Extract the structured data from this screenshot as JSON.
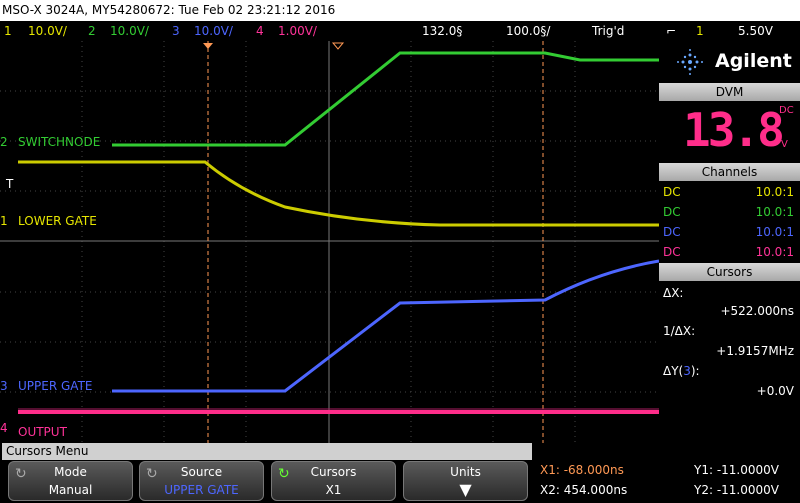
{
  "title_bar": "MSO-X 3024A, MY54280672: Tue Feb 02 23:21:12 2016",
  "channel_bar": {
    "ch1": {
      "num": "1",
      "scale": "10.0V/",
      "color": "#e6e600"
    },
    "ch2": {
      "num": "2",
      "scale": "10.0V/",
      "color": "#33cc33"
    },
    "ch3": {
      "num": "3",
      "scale": "10.0V/",
      "color": "#4d66ff"
    },
    "ch4": {
      "num": "4",
      "scale": "1.00V/",
      "color": "#ff3399"
    },
    "timebase": "132.0§",
    "timediv": "100.0§/",
    "trig_status": "Trig'd",
    "trig_source": "1",
    "trig_level": "5.50V"
  },
  "traces": {
    "switchnode": "SWITCHNODE",
    "lower_gate": "LOWER GATE",
    "upper_gate": "UPPER GATE",
    "output": "OUTPUT",
    "marker_2": "2",
    "marker_1": "1",
    "marker_3": "3",
    "marker_4": "4",
    "marker_t": "T"
  },
  "brand": "Agilent",
  "dvm": {
    "header": "DVM",
    "value": "13.8",
    "mode": "DC",
    "unit": "V"
  },
  "channels": {
    "header": "Channels",
    "rows": [
      {
        "coupling": "DC",
        "probe": "10.0:1",
        "color": "#e6e600"
      },
      {
        "coupling": "DC",
        "probe": "10.0:1",
        "color": "#33cc33"
      },
      {
        "coupling": "DC",
        "probe": "10.0:1",
        "color": "#4d66ff"
      },
      {
        "coupling": "DC",
        "probe": "10.0:1",
        "color": "#ff3399"
      }
    ]
  },
  "cursors_panel": {
    "header": "Cursors",
    "dx_label": "ΔX:",
    "dx_value": "+522.000ns",
    "inv_label": "1/ΔX:",
    "inv_value": "+1.9157MHz",
    "dy_label": "ΔY(",
    "dy_channel": "3",
    "dy_close": "):",
    "dy_value": "+0.0V"
  },
  "menu": {
    "title": "Cursors Menu",
    "mode": {
      "label": "Mode",
      "value": "Manual"
    },
    "source": {
      "label": "Source",
      "value": "UPPER GATE"
    },
    "cursors": {
      "label": "Cursors",
      "value": "X1"
    },
    "units": {
      "label": "Units"
    }
  },
  "readouts": {
    "x1": "X1: -68.000ns",
    "x2": "X2: 454.000ns",
    "y1": "Y1: -11.0000V",
    "y2": "Y2: -11.0000V"
  }
}
